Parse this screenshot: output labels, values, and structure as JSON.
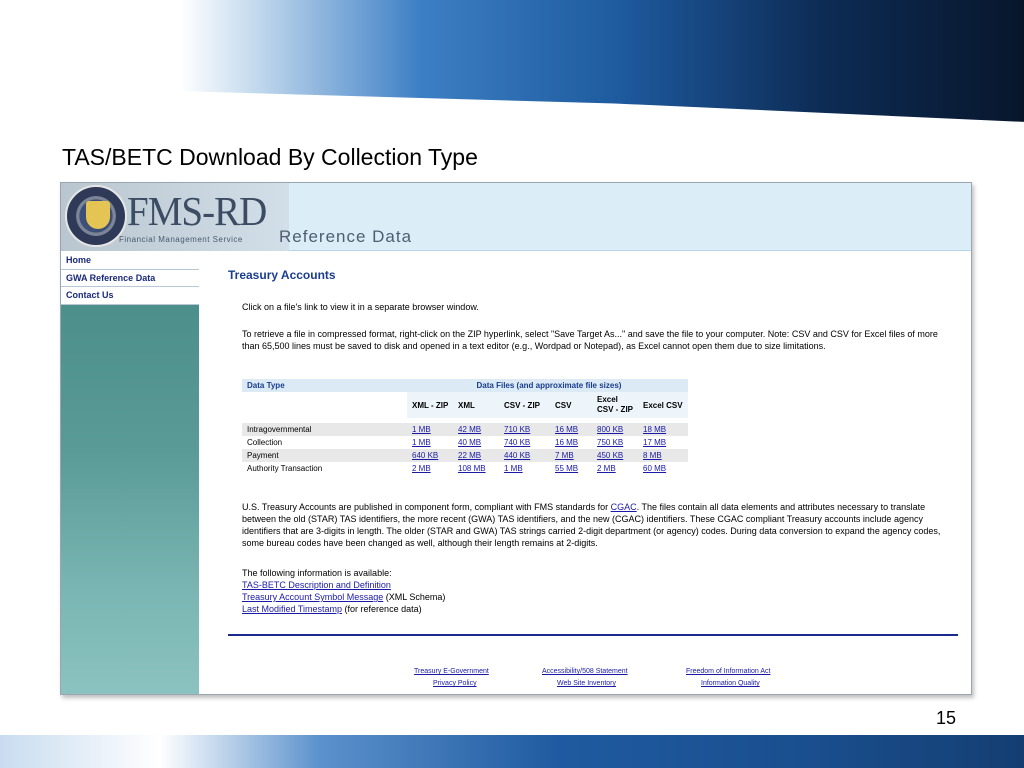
{
  "slide": {
    "title": "TAS/BETC Download By Collection Type",
    "number": "15"
  },
  "header": {
    "logo": "FMS-RD",
    "logo_subtitle": "Financial Management Service",
    "site_name": "Reference Data"
  },
  "sidebar": {
    "items": [
      {
        "label": "Home"
      },
      {
        "label": "GWA Reference Data"
      },
      {
        "label": "Contact Us"
      }
    ]
  },
  "main": {
    "title": "Treasury Accounts",
    "intro": "Click on a file's link to view it in a separate browser window.",
    "zip_note": "To retrieve a file in compressed format, right-click on the ZIP hyperlink, select \"Save Target As...\" and save the file to your computer. Note: CSV and CSV for Excel files of more than 65,500 lines must be saved to disk and opened in a text editor (e.g., Wordpad or Notepad), as Excel cannot open them due to size limitations.",
    "table": {
      "type_header": "Data Type",
      "files_header": "Data Files (and approximate file sizes)",
      "columns": [
        "XML - ZIP",
        "XML",
        "CSV - ZIP",
        "CSV",
        "Excel CSV - ZIP",
        "Excel CSV"
      ],
      "rows": [
        {
          "type": "Intragovernmental",
          "sizes": [
            "1 MB",
            "42 MB",
            "710 KB",
            "16 MB",
            "800 KB",
            "18 MB"
          ]
        },
        {
          "type": "Collection",
          "sizes": [
            "1 MB",
            "40 MB",
            "740 KB",
            "16 MB",
            "750 KB",
            "17 MB"
          ]
        },
        {
          "type": "Payment",
          "sizes": [
            "640 KB",
            "22 MB",
            "440 KB",
            "7 MB",
            "450 KB",
            "8 MB"
          ]
        },
        {
          "type": "Authority Transaction",
          "sizes": [
            "2 MB",
            "108 MB",
            "1 MB",
            "55 MB",
            "2 MB",
            "60 MB"
          ]
        }
      ]
    },
    "cgac_before": "U.S. Treasury Accounts are published in component form, compliant with FMS standards for ",
    "cgac_link": "CGAC",
    "cgac_after": ". The files contain all data elements and attributes necessary to translate between the old (STAR) TAS identifiers, the more recent (GWA) TAS identifiers, and the new (CGAC) identifiers. These CGAC compliant Treasury accounts include agency identifiers that are 3-digits in length. The older (STAR and GWA) TAS strings carried 2-digit department (or agency) codes. During data conversion to expand the agency codes, some bureau codes have been changed as well, although their length remains at 2-digits.",
    "available_label": "The following information is available:",
    "links": {
      "description": "TAS-BETC Description and Definition",
      "symbol_message": "Treasury Account Symbol Message",
      "symbol_suffix": " (XML Schema)",
      "timestamp": "Last Modified Timestamp",
      "timestamp_suffix": " (for reference data)"
    }
  },
  "footer": {
    "links": [
      "Treasury E-Government",
      "Accessibility/508 Statement",
      "Freedom of Information Act",
      "Privacy Policy",
      "Web Site Inventory",
      "Information Quality"
    ]
  }
}
